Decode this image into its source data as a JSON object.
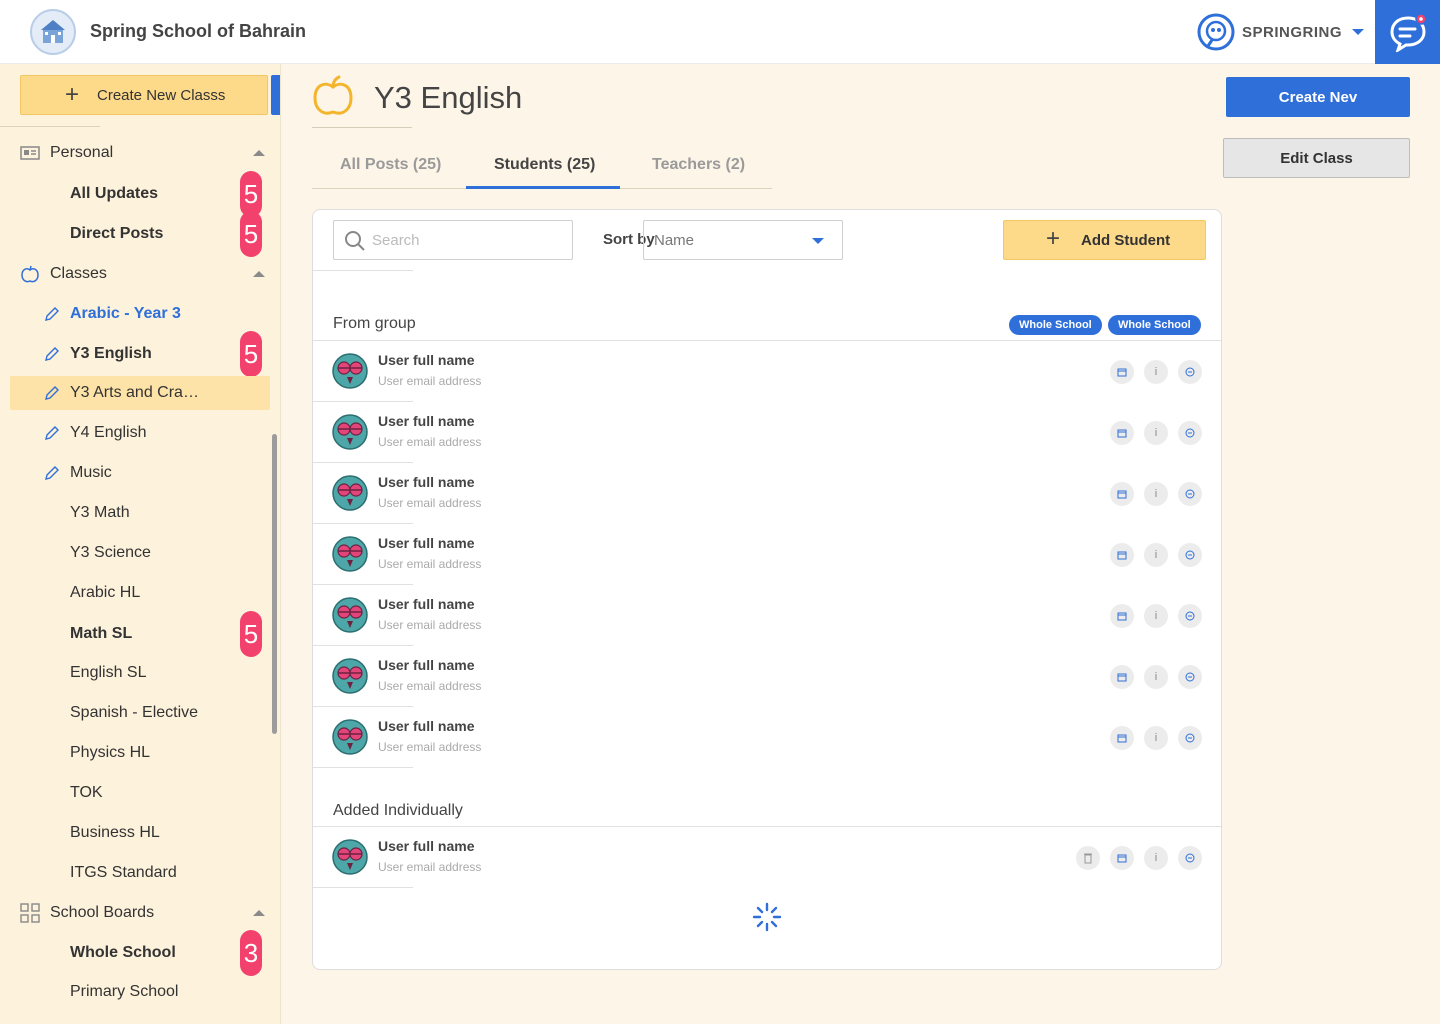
{
  "header": {
    "school_name": "Spring School of Bahrain",
    "brand_name": "SPRINGRING"
  },
  "colors": {
    "accent": "#2f6fd9",
    "badge": "#f2416d",
    "highlight": "#fdd98a",
    "sidebar_bg": "#fdf2dc"
  },
  "sidebar": {
    "create_class_label": "Create New Classs",
    "sections": {
      "personal": "Personal",
      "classes": "Classes",
      "school_boards": "School Boards"
    },
    "personal_items": [
      {
        "label": "All Updates",
        "badge": "5"
      },
      {
        "label": "Direct Posts",
        "badge": "5"
      }
    ],
    "class_items": [
      {
        "label": "Arabic - Year 3"
      },
      {
        "label": "Y3 English",
        "badge": "5"
      },
      {
        "label": "Y3 Arts and Cra…"
      },
      {
        "label": "Y4 English"
      },
      {
        "label": "Music"
      },
      {
        "label": "Y3 Math"
      },
      {
        "label": "Y3 Science"
      },
      {
        "label": "Arabic HL"
      },
      {
        "label": "Math SL",
        "badge": "5"
      },
      {
        "label": "English SL"
      },
      {
        "label": "Spanish - Elective"
      },
      {
        "label": "Physics HL"
      },
      {
        "label": "TOK"
      },
      {
        "label": "Business HL"
      },
      {
        "label": "ITGS Standard"
      }
    ],
    "board_items": [
      {
        "label": "Whole School",
        "badge": "3"
      },
      {
        "label": "Primary School"
      }
    ]
  },
  "main": {
    "class_title": "Y3 English",
    "create_new_label": "Create Nev",
    "edit_class_label": "Edit Class",
    "tabs": [
      {
        "label": "All Posts (25)"
      },
      {
        "label": "Students (25)"
      },
      {
        "label": "Teachers (2)"
      }
    ],
    "search_placeholder": "Search",
    "sort_label": "Sort by",
    "sort_value": "Name",
    "add_student_label": "Add Student",
    "from_group_title": "From group",
    "group_pills": [
      "Whole School",
      "Whole School"
    ],
    "added_individually_title": "Added Individually",
    "user_name": "User full name",
    "user_email": "User email address",
    "info_glyph": "i"
  }
}
